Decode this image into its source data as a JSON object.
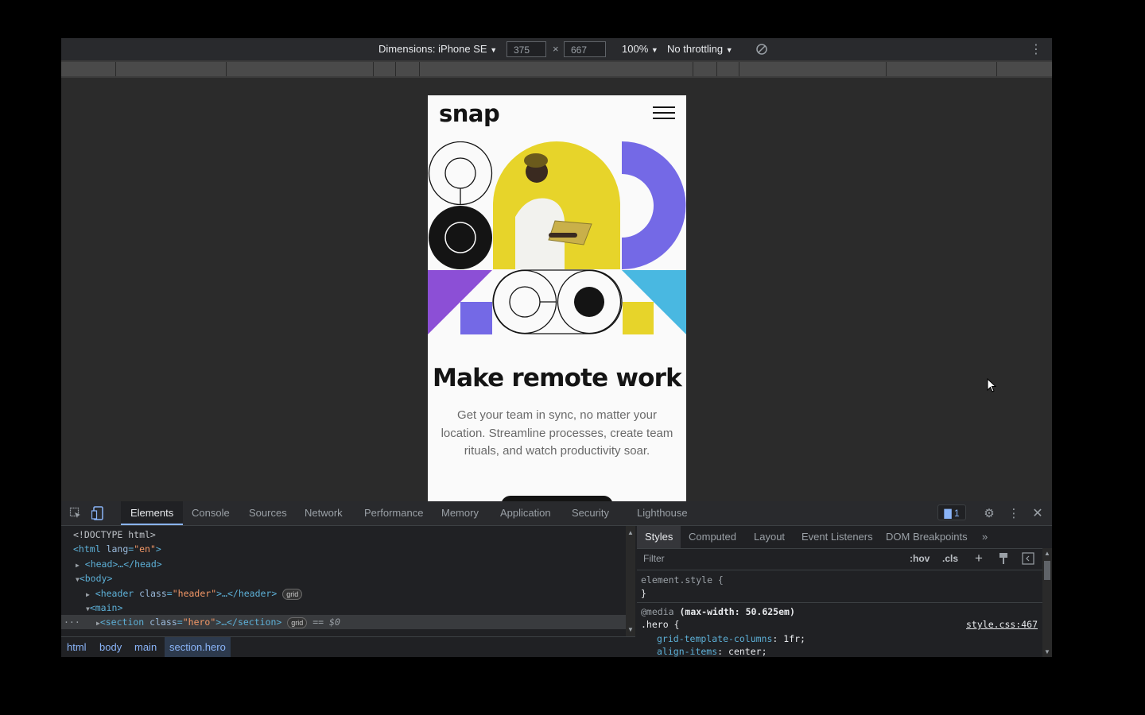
{
  "device_toolbar": {
    "dimensions_label": "Dimensions: iPhone SE",
    "width_value": "375",
    "times_sign": "×",
    "height_value": "667",
    "zoom_label": "100%",
    "throttling_label": "No throttling"
  },
  "page": {
    "logo": "snap",
    "hero_title": "Make remote work",
    "hero_text": "Get your team in sync, no matter your location. Streamline processes, create team rituals, and watch productivity soar.",
    "colors": {
      "yellow": "#e7d42a",
      "purple": "#7469e6",
      "violet": "#8c4fd6",
      "cyan": "#49b8e1",
      "dark": "#141414"
    }
  },
  "panel": {
    "tabs": [
      "Elements",
      "Console",
      "Sources",
      "Network",
      "Performance",
      "Memory",
      "Application",
      "Security",
      "Lighthouse"
    ],
    "issues_count": "1"
  },
  "elements": {
    "line_doctype": "<!DOCTYPE html>",
    "html_open": "<html",
    "html_attr": "lang",
    "html_val": "\"en\"",
    "head": "<head>…</head>",
    "body_open": "<body>",
    "header_open": "<header",
    "header_attr": "class",
    "header_val": "\"header\"",
    "header_close": ">…</header>",
    "main_open": "<main>",
    "section_open": "<section",
    "section_attr": "class",
    "section_val": "\"hero\"",
    "section_close": ">…</section>",
    "grid_pill": "grid",
    "eq_dollar": "== $0",
    "ellipsis": "···"
  },
  "breadcrumbs": [
    "html",
    "body",
    "main",
    "section.hero"
  ],
  "styles": {
    "tabs": [
      "Styles",
      "Computed",
      "Layout",
      "Event Listeners",
      "DOM Breakpoints"
    ],
    "more": "»",
    "filter_placeholder": "Filter",
    "hov": ":hov",
    "cls": ".cls",
    "element_style": "element.style {",
    "close_brace": "}",
    "media_keyword": "@media",
    "media_query": "(max-width: 50.625em)",
    "selector": ".hero {",
    "source_link": "style.css:467",
    "prop1_name": "grid-template-columns",
    "prop1_value": "1fr;",
    "prop2_name": "align-items",
    "prop2_value": "center;"
  }
}
